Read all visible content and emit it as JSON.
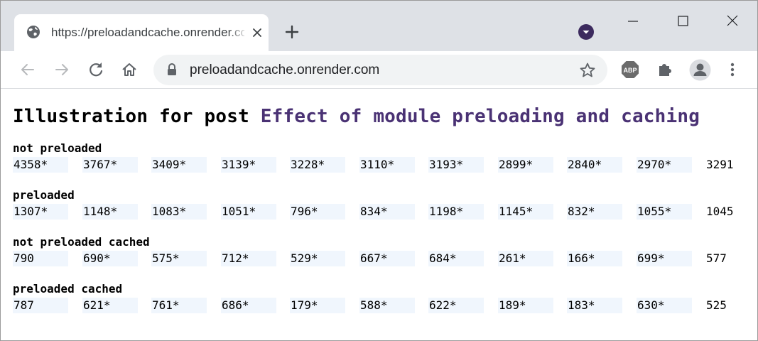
{
  "browser": {
    "tab_title": "https://preloadandcache.onrender.com",
    "url": "preloadandcache.onrender.com",
    "extension_badge": "ABP"
  },
  "page": {
    "title_prefix": "Illustration for post ",
    "title_link": "Effect of module preloading and caching"
  },
  "sections": [
    {
      "label": "not preloaded",
      "values": [
        "4358*",
        "3767*",
        "3409*",
        "3139*",
        "3228*",
        "3110*",
        "3193*",
        "2899*",
        "2840*",
        "2970*",
        "3291"
      ]
    },
    {
      "label": "preloaded",
      "values": [
        "1307*",
        "1148*",
        "1083*",
        "1051*",
        "796*",
        "834*",
        "1198*",
        "1145*",
        "832*",
        "1055*",
        "1045"
      ]
    },
    {
      "label": "not preloaded cached",
      "values": [
        "790",
        "690*",
        "575*",
        "712*",
        "529*",
        "667*",
        "684*",
        "261*",
        "166*",
        "699*",
        "577"
      ]
    },
    {
      "label": "preloaded cached",
      "values": [
        "787",
        "621*",
        "761*",
        "686*",
        "179*",
        "588*",
        "622*",
        "189*",
        "183*",
        "630*",
        "525"
      ]
    }
  ],
  "colors": {
    "tabstrip": "#dee1e6",
    "link": "#4a3274",
    "cell_shade": "#f0f6fd",
    "abp_red": "#e8333c",
    "icon_gray": "#5f6368"
  },
  "icons": {
    "favicon": "globe-icon",
    "tab_close": "close-icon",
    "new_tab": "plus-icon",
    "tab_search": "tab-search-icon",
    "back": "arrow-left-icon",
    "forward": "arrow-right-icon",
    "reload": "reload-icon",
    "home": "home-icon",
    "lock": "lock-icon",
    "bookmark": "star-icon",
    "extensions": "puzzle-icon",
    "profile": "avatar-icon",
    "menu": "kebab-menu-icon"
  }
}
